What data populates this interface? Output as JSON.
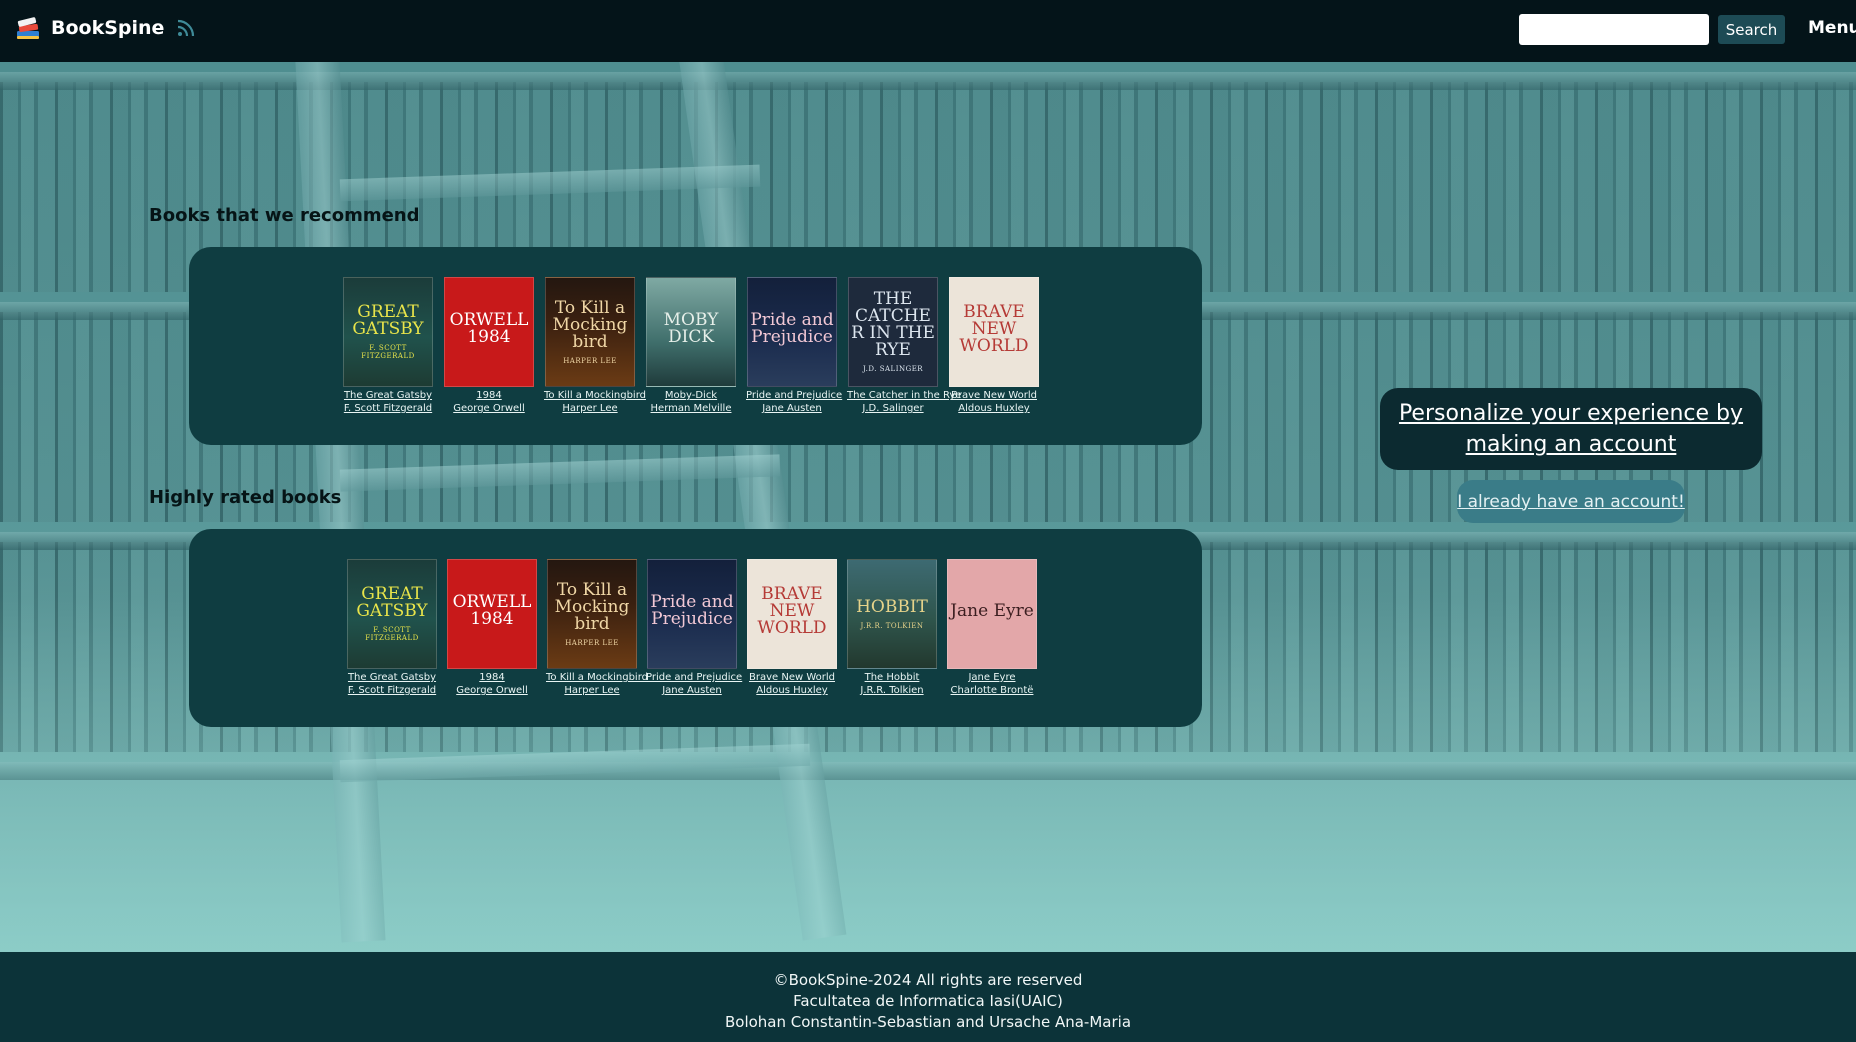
{
  "header": {
    "brand_name": "BookSpine",
    "logo_icon": "books-stack-icon",
    "feed_icon": "rss-icon",
    "search_placeholder": "",
    "search_value": "",
    "search_label": "Search",
    "menu_label": "Menu"
  },
  "recommended": {
    "title": "Books that we recommend",
    "books": [
      {
        "title": "The Great Gatsby",
        "author": "F. Scott Fitzgerald",
        "cover_text": "GREAT GATSBY",
        "cover_author": "F. SCOTT FITZGERALD",
        "cover_style": "c-gatsby"
      },
      {
        "title": "1984",
        "author": "George Orwell",
        "cover_text": "ORWELL 1984",
        "cover_author": "",
        "cover_style": "c-1984"
      },
      {
        "title": "To Kill a Mockingbird",
        "author": "Harper Lee",
        "cover_text": "To Kill a Mockingbird",
        "cover_author": "HARPER LEE",
        "cover_style": "c-mock"
      },
      {
        "title": "Moby-Dick",
        "author": "Herman Melville",
        "cover_text": "MOBY DICK",
        "cover_author": "",
        "cover_style": "c-moby"
      },
      {
        "title": "Pride and Prejudice",
        "author": "Jane Austen",
        "cover_text": "Pride and Prejudice",
        "cover_author": "",
        "cover_style": "c-pride"
      },
      {
        "title": "The Catcher in the Rye",
        "author": "J.D. Salinger",
        "cover_text": "THE CATCHER IN THE RYE",
        "cover_author": "J.D. SALINGER",
        "cover_style": "c-catcher"
      },
      {
        "title": "Brave New World",
        "author": "Aldous Huxley",
        "cover_text": "BRAVE NEW WORLD",
        "cover_author": "",
        "cover_style": "c-brave"
      }
    ]
  },
  "highly_rated": {
    "title": "Highly rated books",
    "books": [
      {
        "title": "The Great Gatsby",
        "author": "F. Scott Fitzgerald",
        "cover_text": "GREAT GATSBY",
        "cover_author": "F. SCOTT FITZGERALD",
        "cover_style": "c-gatsby"
      },
      {
        "title": "1984",
        "author": "George Orwell",
        "cover_text": "ORWELL 1984",
        "cover_author": "",
        "cover_style": "c-1984"
      },
      {
        "title": "To Kill a Mockingbird",
        "author": "Harper Lee",
        "cover_text": "To Kill a Mockingbird",
        "cover_author": "HARPER LEE",
        "cover_style": "c-mock"
      },
      {
        "title": "Pride and Prejudice",
        "author": "Jane Austen",
        "cover_text": "Pride and Prejudice",
        "cover_author": "",
        "cover_style": "c-pride"
      },
      {
        "title": "Brave New World",
        "author": "Aldous Huxley",
        "cover_text": "BRAVE NEW WORLD",
        "cover_author": "",
        "cover_style": "c-brave"
      },
      {
        "title": "The Hobbit",
        "author": "J.R.R. Tolkien",
        "cover_text": "HOBBIT",
        "cover_author": "J.R.R. TOLKIEN",
        "cover_style": "c-hobbit"
      },
      {
        "title": "Jane Eyre",
        "author": "Charlotte Brontë",
        "cover_text": "Jane Eyre",
        "cover_author": "",
        "cover_style": "c-eyre"
      }
    ]
  },
  "cta": {
    "personalize_label": "Personalize your experience by making an account",
    "login_label": "I already have an account!"
  },
  "footer": {
    "line1": "©BookSpine-2024 All rights are reserved",
    "line2": "Facultatea de Informatica Iasi(UAIC)",
    "line3": "Bolohan Constantin-Sebastian and Ursache Ana-Maria"
  },
  "colors": {
    "header_bg": "#041419",
    "card_bg": "#0f3d41",
    "cta_bg": "#0c2a30",
    "login_bg": "#3a7c88",
    "footer_bg": "#0c3339",
    "search_button_bg": "#1d4b55"
  }
}
